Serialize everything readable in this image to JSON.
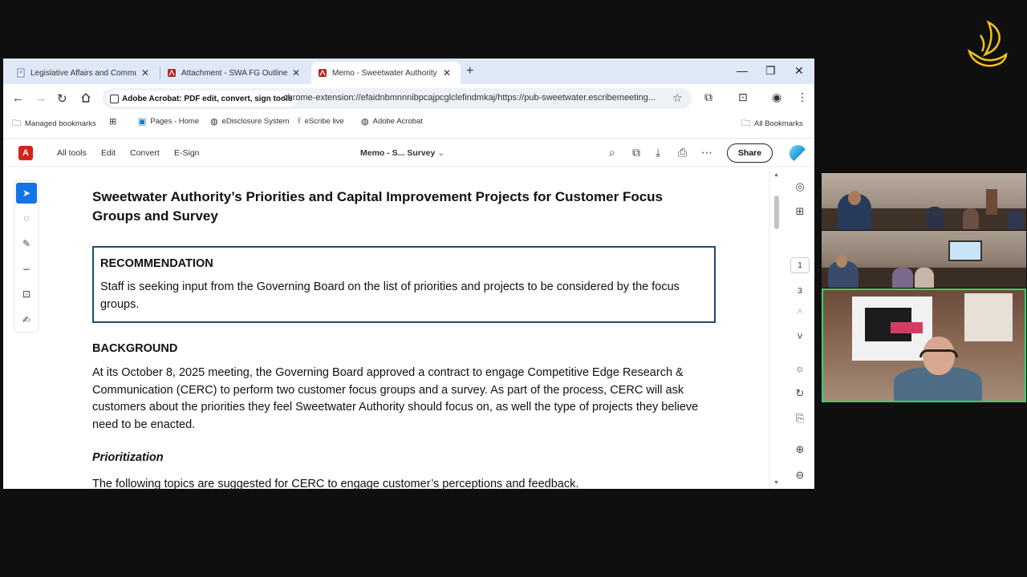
{
  "tabs": [
    {
      "label": "Legislative Affairs and Commun",
      "icon": "document-icon",
      "active": false
    },
    {
      "label": "Attachment - SWA FG Outline.p",
      "icon": "pdf-icon",
      "active": false
    },
    {
      "label": "Memo - Sweetwater Authority",
      "icon": "pdf-icon",
      "active": true
    }
  ],
  "omnibox": {
    "site_chip": "Adobe Acrobat: PDF edit, convert, sign tools",
    "url": "chrome-extension://efaidnbmnnnibpcajpcglclefindmkaj/https://pub-sweetwater.escribemeeting..."
  },
  "bookmarks": [
    {
      "label": "Managed bookmarks",
      "icon": "folder-icon"
    },
    {
      "label": "Pages - Home",
      "icon": "sharepoint-icon"
    },
    {
      "label": "eDisclosure System",
      "icon": "globe-icon"
    },
    {
      "label": "eScribe live",
      "icon": "escribe-icon"
    },
    {
      "label": "Adobe Acrobat",
      "icon": "globe-icon"
    }
  ],
  "all_bookmarks": "All Bookmarks",
  "acrobat": {
    "menu": [
      "All tools",
      "Edit",
      "Convert",
      "E-Sign"
    ],
    "doc_title": "Memo - S... Survey",
    "share": "Share"
  },
  "document": {
    "title": "Sweetwater Authority’s Priorities and Capital Improvement Projects for Customer Focus Groups and Survey",
    "recommendation_heading": "RECOMMENDATION",
    "recommendation_text": "Staff is seeking input from the Governing Board on the list of priorities and projects to be considered by the focus groups.",
    "background_heading": "BACKGROUND",
    "background_text": "At its October 8, 2025 meeting, the Governing Board approved a contract to engage Competitive Edge Research & Communication (CERC) to perform two customer focus groups and a survey. As part of the process, CERC will ask customers about the priorities they feel Sweetwater Authority should focus on, as well the type of projects they believe need to be enacted.",
    "prioritization_heading": "Prioritization",
    "prioritization_text": "The following topics are suggested for CERC to engage customer’s perceptions and feedback."
  },
  "pages": {
    "current": "1",
    "total": "3"
  },
  "colors": {
    "accent": "#1473e6",
    "acrobat_red": "#d1251a",
    "recommendation_border": "#1e4c70",
    "active_speaker": "#35d36b"
  }
}
